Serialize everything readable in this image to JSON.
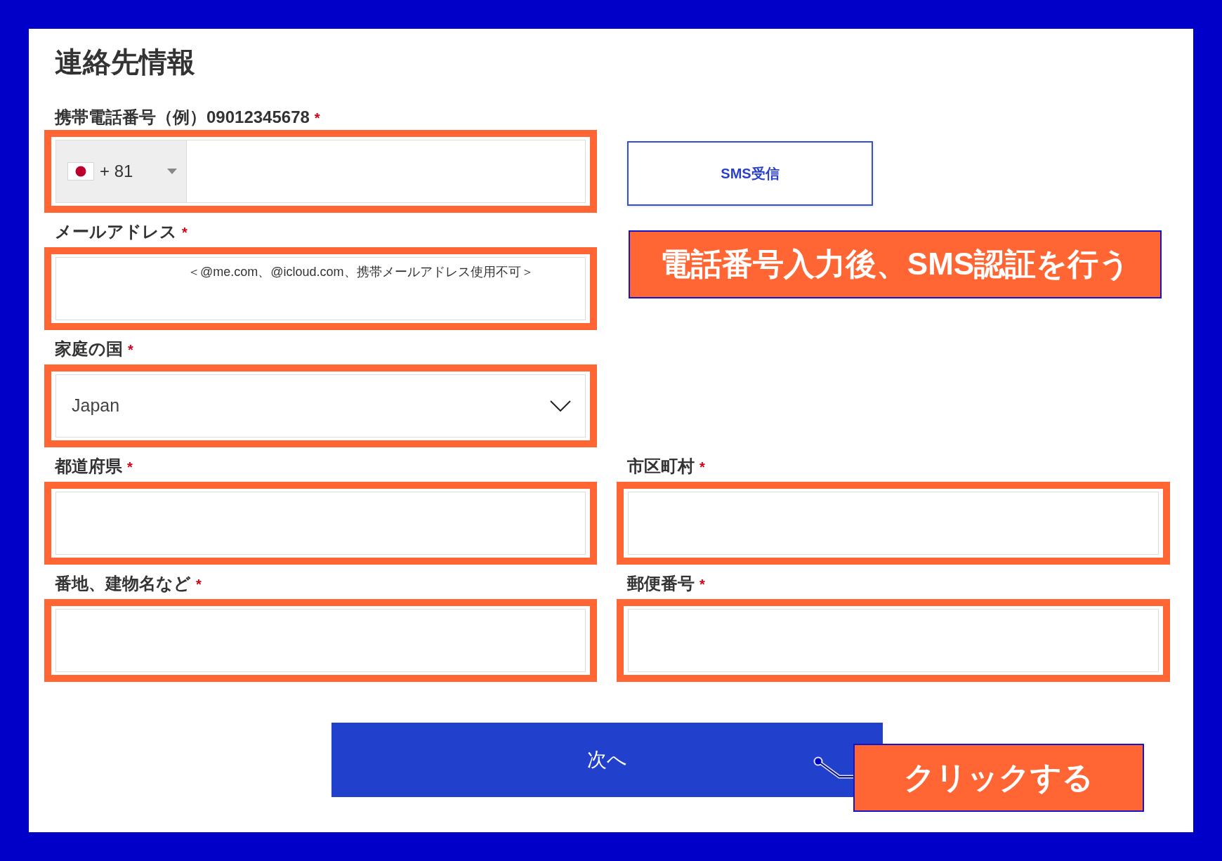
{
  "title": "連絡先情報",
  "phone": {
    "label": "携帯電話番号（例）09012345678",
    "required_mark": "*",
    "country_code": "+ 81",
    "highlighted": true
  },
  "sms_button": {
    "label": "SMS受信",
    "callout": {
      "text": "電話番号入力後、SMS認証を行う"
    }
  },
  "email": {
    "label": "メールアドレス",
    "required_mark": "*",
    "placeholder": "＜@me.com、@icloud.com、携帯メールアドレス使用不可＞",
    "highlighted": true
  },
  "country": {
    "label": "家庭の国",
    "required_mark": "*",
    "value": "Japan",
    "highlighted": true
  },
  "address_fields": [
    {
      "label": "都道府県",
      "required_mark": "*",
      "highlighted": true
    },
    {
      "label": "市区町村",
      "required_mark": "*",
      "highlighted": true
    },
    {
      "label": "番地、建物名など",
      "required_mark": "*",
      "highlighted": true
    },
    {
      "label": "郵便番号",
      "required_mark": "*",
      "highlighted": true
    }
  ],
  "next_button": {
    "label": "次へ",
    "callout": {
      "text": "クリックする",
      "pointer": true
    }
  }
}
